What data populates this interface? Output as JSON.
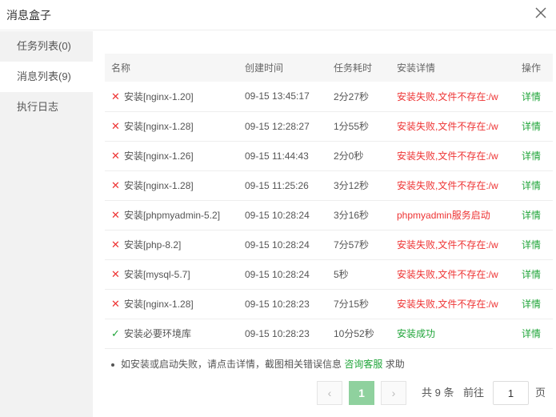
{
  "window": {
    "title": "消息盒子"
  },
  "sidebar": {
    "items": [
      {
        "label": "任务列表(0)"
      },
      {
        "label": "消息列表(9)"
      },
      {
        "label": "执行日志"
      }
    ]
  },
  "table": {
    "headers": [
      "名称",
      "创建时间",
      "任务耗时",
      "安装详情",
      "操作"
    ],
    "rows": [
      {
        "status": "fail",
        "name": "安装[nginx-1.20]",
        "time": "09-15 13:45:17",
        "duration": "2分27秒",
        "detail": "安装失败,文件不存在:/w",
        "op": "详情"
      },
      {
        "status": "fail",
        "name": "安装[nginx-1.28]",
        "time": "09-15 12:28:27",
        "duration": "1分55秒",
        "detail": "安装失败,文件不存在:/w",
        "op": "详情"
      },
      {
        "status": "fail",
        "name": "安装[nginx-1.26]",
        "time": "09-15 11:44:43",
        "duration": "2分0秒",
        "detail": "安装失败,文件不存在:/w",
        "op": "详情"
      },
      {
        "status": "fail",
        "name": "安装[nginx-1.28]",
        "time": "09-15 11:25:26",
        "duration": "3分12秒",
        "detail": "安装失败,文件不存在:/w",
        "op": "详情"
      },
      {
        "status": "fail",
        "name": "安装[phpmyadmin-5.2]",
        "time": "09-15 10:28:24",
        "duration": "3分16秒",
        "detail": "phpmyadmin服务启动",
        "op": "详情"
      },
      {
        "status": "fail",
        "name": "安装[php-8.2]",
        "time": "09-15 10:28:24",
        "duration": "7分57秒",
        "detail": "安装失败,文件不存在:/w",
        "op": "详情"
      },
      {
        "status": "fail",
        "name": "安装[mysql-5.7]",
        "time": "09-15 10:28:24",
        "duration": "5秒",
        "detail": "安装失败,文件不存在:/w",
        "op": "详情"
      },
      {
        "status": "fail",
        "name": "安装[nginx-1.28]",
        "time": "09-15 10:28:23",
        "duration": "7分15秒",
        "detail": "安装失败,文件不存在:/w",
        "op": "详情"
      },
      {
        "status": "ok",
        "name": "安装必要环境库",
        "time": "09-15 10:28:23",
        "duration": "10分52秒",
        "detail": "安装成功",
        "op": "详情"
      }
    ]
  },
  "tip": {
    "text": "如安装或启动失败，请点击详情，截图相关错误信息",
    "link": "咨询客服",
    "suffix": "求助"
  },
  "pagination": {
    "prev": "‹",
    "next": "›",
    "current_page": "1",
    "total_text": "共 9 条",
    "goto_label": "前往",
    "page_input": "1",
    "page_unit": "页"
  },
  "colors": {
    "accent": "#20a53a",
    "error": "#ee3333",
    "pager_active": "#8fd19e"
  }
}
